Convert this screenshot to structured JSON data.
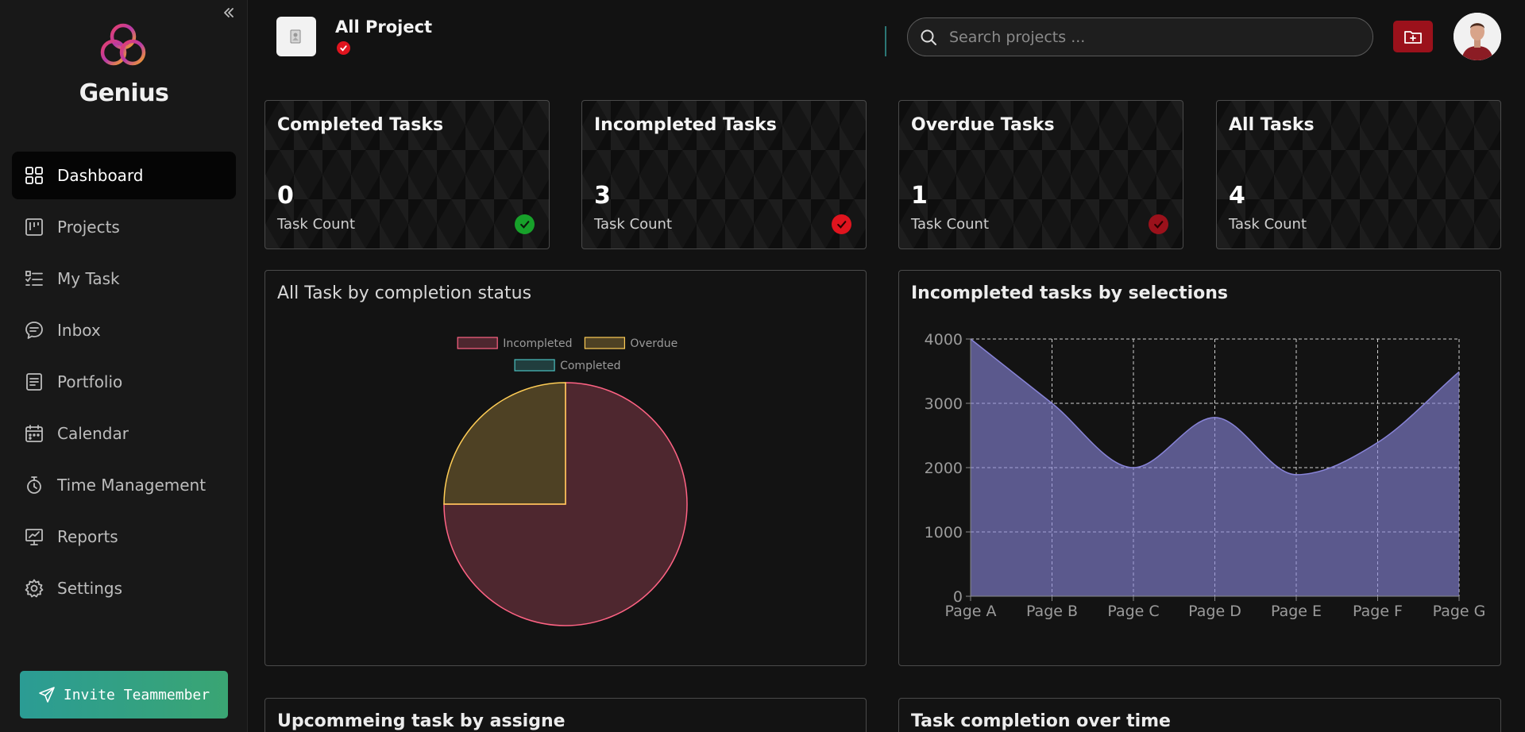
{
  "sidebar": {
    "brand": "Genius",
    "nav": [
      {
        "label": "Dashboard",
        "icon": "grid-icon",
        "active": true
      },
      {
        "label": "Projects",
        "icon": "kanban-icon"
      },
      {
        "label": "My Task",
        "icon": "checklist-icon"
      },
      {
        "label": "Inbox",
        "icon": "chat-bubble-icon"
      },
      {
        "label": "Portfolio",
        "icon": "document-icon"
      },
      {
        "label": "Calendar",
        "icon": "calendar-icon"
      },
      {
        "label": "Time Management",
        "icon": "timer-icon"
      },
      {
        "label": "Reports",
        "icon": "presentation-chart-icon"
      },
      {
        "label": "Settings",
        "icon": "gear-icon"
      }
    ],
    "invite_label": "Invite Teammember"
  },
  "header": {
    "project_title": "All Project",
    "search_placeholder": "Search projects ..."
  },
  "cards": [
    {
      "title": "Completed Tasks",
      "value": "0",
      "label": "Task Count",
      "badge_color": "#17a12a"
    },
    {
      "title": "Incompleted Tasks",
      "value": "3",
      "label": "Task Count",
      "badge_color": "#e0141e"
    },
    {
      "title": "Overdue Tasks",
      "value": "1",
      "label": "Task Count",
      "badge_color": "#9b111b"
    },
    {
      "title": "All Tasks",
      "value": "4",
      "label": "Task Count",
      "badge_color": ""
    }
  ],
  "panels": {
    "pie_title": "All Task by completion status",
    "area_title": "Incompleted tasks by selections",
    "assignee_title": "Upcommeing task by assigne",
    "completion_title": "Task completion over time"
  },
  "chart_data": [
    {
      "type": "pie",
      "title": "All Task by completion status",
      "categories": [
        "Incompleted",
        "Overdue",
        "Completed"
      ],
      "values": [
        3,
        1,
        0
      ],
      "colors": [
        "#ff6384",
        "#ffcd56",
        "#4bc0c0"
      ],
      "legend": "top"
    },
    {
      "type": "area",
      "title": "Incompleted tasks by selections",
      "categories": [
        "Page A",
        "Page B",
        "Page C",
        "Page D",
        "Page E",
        "Page F",
        "Page G"
      ],
      "values": [
        4000,
        3000,
        2000,
        2780,
        1890,
        2390,
        3490
      ],
      "ylim": [
        0,
        4000
      ],
      "yticks": [
        0,
        1000,
        2000,
        3000,
        4000
      ],
      "color": "#8884d8",
      "grid": true
    }
  ]
}
